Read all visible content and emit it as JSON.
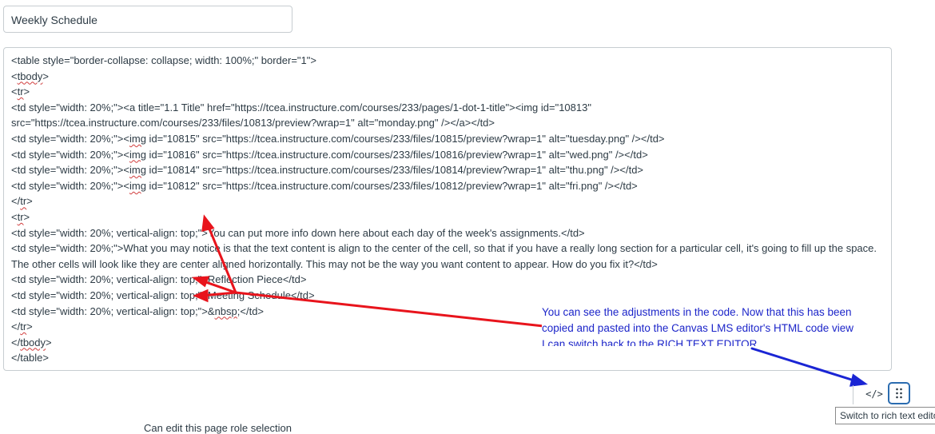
{
  "page_title_input": {
    "value": "Weekly Schedule"
  },
  "html_editor": {
    "lines": [
      {
        "parts": [
          {
            "t": "<table style=\"border-collapse: collapse; width: 100%;\" border=\"1\">"
          }
        ]
      },
      {
        "parts": [
          {
            "t": "<"
          },
          {
            "t": "tbody",
            "sq": true
          },
          {
            "t": ">"
          }
        ]
      },
      {
        "parts": [
          {
            "t": "<"
          },
          {
            "t": "tr",
            "sq": true
          },
          {
            "t": ">"
          }
        ]
      },
      {
        "parts": [
          {
            "t": "<td style=\"width: 20%;\"><a title=\"1.1 Title\" href=\"https://tcea.instructure.com/courses/233/pages/1-dot-1-title\"><img id=\"10813\""
          }
        ]
      },
      {
        "parts": [
          {
            "t": "src=\"https://tcea.instructure.com/courses/233/files/10813/preview?wrap=1\" alt=\"monday.png\" /></a></td>"
          }
        ]
      },
      {
        "parts": [
          {
            "t": "<td style=\"width: 20%;\"><"
          },
          {
            "t": "img",
            "sq": true
          },
          {
            "t": " id=\"10815\" src=\"https://tcea.instructure.com/courses/233/files/10815/preview?wrap=1\" alt=\"tuesday.png\" /></td>"
          }
        ]
      },
      {
        "parts": [
          {
            "t": "<td style=\"width: 20%;\"><"
          },
          {
            "t": "img",
            "sq": true
          },
          {
            "t": " id=\"10816\" src=\"https://tcea.instructure.com/courses/233/files/10816/preview?wrap=1\" alt=\"wed.png\" /></td>"
          }
        ]
      },
      {
        "parts": [
          {
            "t": "<td style=\"width: 20%;\"><"
          },
          {
            "t": "img",
            "sq": true
          },
          {
            "t": " id=\"10814\" src=\"https://tcea.instructure.com/courses/233/files/10814/preview?wrap=1\" alt=\"thu.png\" /></td>"
          }
        ]
      },
      {
        "parts": [
          {
            "t": "<td style=\"width: 20%;\"><"
          },
          {
            "t": "img",
            "sq": true
          },
          {
            "t": " id=\"10812\" src=\"https://tcea.instructure.com/courses/233/files/10812/preview?wrap=1\" alt=\"fri.png\" /></td>"
          }
        ]
      },
      {
        "parts": [
          {
            "t": "</"
          },
          {
            "t": "tr",
            "sq": true
          },
          {
            "t": ">"
          }
        ]
      },
      {
        "parts": [
          {
            "t": "<"
          },
          {
            "t": "tr",
            "sq": true
          },
          {
            "t": ">"
          }
        ]
      },
      {
        "parts": [
          {
            "t": "<td style=\"width: 20%; vertical-align: top;\">You can put more info down here about each day of the week's assignments.</td>"
          }
        ]
      },
      {
        "wrap": true,
        "parts": [
          {
            "t": "<td style=\"width: 20%;\">What you may notice is that the text content is align to the center of the cell, so that if you have a really long section for a particular cell, it's going to fill up the space. The other cells will look like they are center aligned horizontally. This may not be the way you want content to appear. How do you fix it?</td>"
          }
        ]
      },
      {
        "parts": [
          {
            "t": "<td style=\"width: 20%; vertical-align: top;\">Reflection Piece</td>"
          }
        ]
      },
      {
        "parts": [
          {
            "t": "<td style=\"width: 20%; vertical-align: top;\">Meeting Schedule</td>"
          }
        ]
      },
      {
        "parts": [
          {
            "t": "<td style=\"width: 20%; vertical-align: top;\">&"
          },
          {
            "t": "nbsp",
            "sq": true
          },
          {
            "t": ";</td>"
          }
        ]
      },
      {
        "parts": [
          {
            "t": "</"
          },
          {
            "t": "tr",
            "sq": true
          },
          {
            "t": ">"
          }
        ]
      },
      {
        "parts": [
          {
            "t": "</"
          },
          {
            "t": "tbody",
            "sq": true
          },
          {
            "t": ">"
          }
        ]
      },
      {
        "parts": [
          {
            "t": "</table>"
          }
        ]
      }
    ]
  },
  "annotation": {
    "lines": [
      "You can see the adjustments in the code. Now that this has been",
      "copied and pasted into the Canvas LMS editor's HTML code view",
      "I can switch back to the RICH TEXT EDITOR."
    ],
    "color": "#1c25c9"
  },
  "arrow_colors": {
    "red": "#e8141c",
    "blue": "#1a25d4"
  },
  "toolbar": {
    "html_toggle_label": "</>",
    "resize_icon": "grip-dots-icon",
    "tooltip": "Switch to rich text editor"
  },
  "bottom_text": "Can edit this page role selection"
}
